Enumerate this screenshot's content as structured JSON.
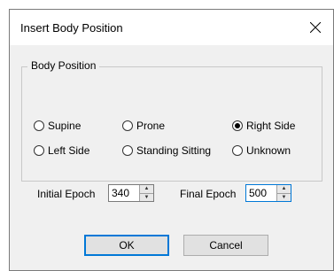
{
  "dialog": {
    "title": "Insert Body Position"
  },
  "group": {
    "label": "Body Position",
    "options": [
      {
        "label": "Supine",
        "checked": false
      },
      {
        "label": "Prone",
        "checked": false
      },
      {
        "label": "Right Side",
        "checked": true
      },
      {
        "label": "Left Side",
        "checked": false
      },
      {
        "label": "Standing Sitting",
        "checked": false
      },
      {
        "label": "Unknown",
        "checked": false
      }
    ]
  },
  "epochs": {
    "initial_label": "Initial Epoch",
    "initial_value": "340",
    "final_label": "Final Epoch",
    "final_value": "500"
  },
  "buttons": {
    "ok": "OK",
    "cancel": "Cancel"
  },
  "colors": {
    "accent": "#0078d7",
    "dialog_bg": "#f0f0f0"
  },
  "icons": {
    "close": "close-icon",
    "spin_up": "spin-up-icon",
    "spin_down": "spin-down-icon"
  }
}
